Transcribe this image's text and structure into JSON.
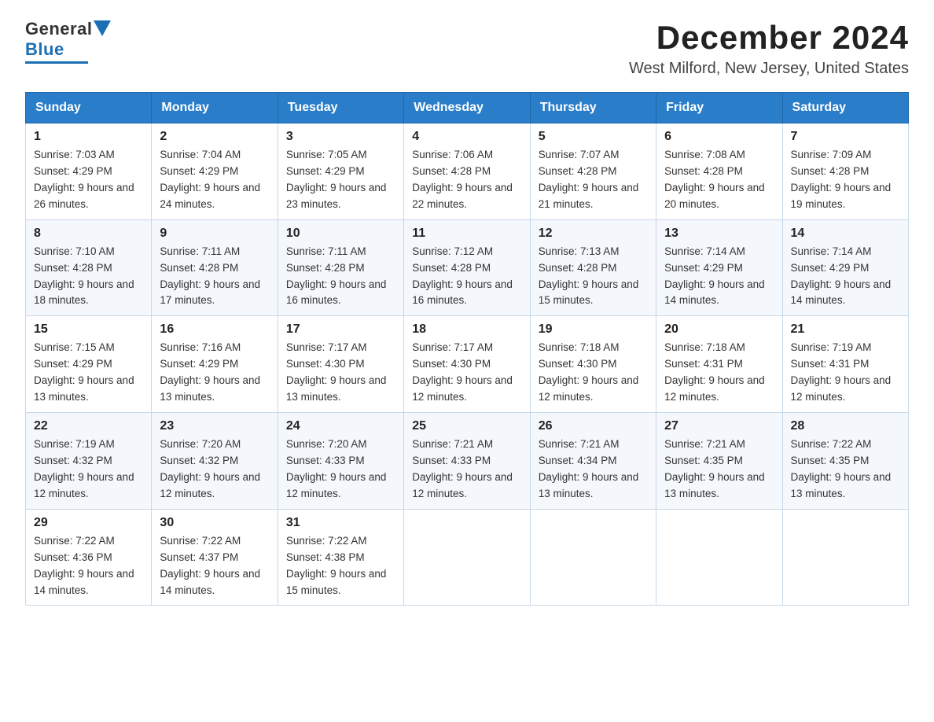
{
  "logo": {
    "general": "General",
    "blue": "Blue"
  },
  "title": "December 2024",
  "location": "West Milford, New Jersey, United States",
  "weekdays": [
    "Sunday",
    "Monday",
    "Tuesday",
    "Wednesday",
    "Thursday",
    "Friday",
    "Saturday"
  ],
  "weeks": [
    [
      {
        "day": "1",
        "sunrise": "7:03 AM",
        "sunset": "4:29 PM",
        "daylight": "9 hours and 26 minutes."
      },
      {
        "day": "2",
        "sunrise": "7:04 AM",
        "sunset": "4:29 PM",
        "daylight": "9 hours and 24 minutes."
      },
      {
        "day": "3",
        "sunrise": "7:05 AM",
        "sunset": "4:29 PM",
        "daylight": "9 hours and 23 minutes."
      },
      {
        "day": "4",
        "sunrise": "7:06 AM",
        "sunset": "4:28 PM",
        "daylight": "9 hours and 22 minutes."
      },
      {
        "day": "5",
        "sunrise": "7:07 AM",
        "sunset": "4:28 PM",
        "daylight": "9 hours and 21 minutes."
      },
      {
        "day": "6",
        "sunrise": "7:08 AM",
        "sunset": "4:28 PM",
        "daylight": "9 hours and 20 minutes."
      },
      {
        "day": "7",
        "sunrise": "7:09 AM",
        "sunset": "4:28 PM",
        "daylight": "9 hours and 19 minutes."
      }
    ],
    [
      {
        "day": "8",
        "sunrise": "7:10 AM",
        "sunset": "4:28 PM",
        "daylight": "9 hours and 18 minutes."
      },
      {
        "day": "9",
        "sunrise": "7:11 AM",
        "sunset": "4:28 PM",
        "daylight": "9 hours and 17 minutes."
      },
      {
        "day": "10",
        "sunrise": "7:11 AM",
        "sunset": "4:28 PM",
        "daylight": "9 hours and 16 minutes."
      },
      {
        "day": "11",
        "sunrise": "7:12 AM",
        "sunset": "4:28 PM",
        "daylight": "9 hours and 16 minutes."
      },
      {
        "day": "12",
        "sunrise": "7:13 AM",
        "sunset": "4:28 PM",
        "daylight": "9 hours and 15 minutes."
      },
      {
        "day": "13",
        "sunrise": "7:14 AM",
        "sunset": "4:29 PM",
        "daylight": "9 hours and 14 minutes."
      },
      {
        "day": "14",
        "sunrise": "7:14 AM",
        "sunset": "4:29 PM",
        "daylight": "9 hours and 14 minutes."
      }
    ],
    [
      {
        "day": "15",
        "sunrise": "7:15 AM",
        "sunset": "4:29 PM",
        "daylight": "9 hours and 13 minutes."
      },
      {
        "day": "16",
        "sunrise": "7:16 AM",
        "sunset": "4:29 PM",
        "daylight": "9 hours and 13 minutes."
      },
      {
        "day": "17",
        "sunrise": "7:17 AM",
        "sunset": "4:30 PM",
        "daylight": "9 hours and 13 minutes."
      },
      {
        "day": "18",
        "sunrise": "7:17 AM",
        "sunset": "4:30 PM",
        "daylight": "9 hours and 12 minutes."
      },
      {
        "day": "19",
        "sunrise": "7:18 AM",
        "sunset": "4:30 PM",
        "daylight": "9 hours and 12 minutes."
      },
      {
        "day": "20",
        "sunrise": "7:18 AM",
        "sunset": "4:31 PM",
        "daylight": "9 hours and 12 minutes."
      },
      {
        "day": "21",
        "sunrise": "7:19 AM",
        "sunset": "4:31 PM",
        "daylight": "9 hours and 12 minutes."
      }
    ],
    [
      {
        "day": "22",
        "sunrise": "7:19 AM",
        "sunset": "4:32 PM",
        "daylight": "9 hours and 12 minutes."
      },
      {
        "day": "23",
        "sunrise": "7:20 AM",
        "sunset": "4:32 PM",
        "daylight": "9 hours and 12 minutes."
      },
      {
        "day": "24",
        "sunrise": "7:20 AM",
        "sunset": "4:33 PM",
        "daylight": "9 hours and 12 minutes."
      },
      {
        "day": "25",
        "sunrise": "7:21 AM",
        "sunset": "4:33 PM",
        "daylight": "9 hours and 12 minutes."
      },
      {
        "day": "26",
        "sunrise": "7:21 AM",
        "sunset": "4:34 PM",
        "daylight": "9 hours and 13 minutes."
      },
      {
        "day": "27",
        "sunrise": "7:21 AM",
        "sunset": "4:35 PM",
        "daylight": "9 hours and 13 minutes."
      },
      {
        "day": "28",
        "sunrise": "7:22 AM",
        "sunset": "4:35 PM",
        "daylight": "9 hours and 13 minutes."
      }
    ],
    [
      {
        "day": "29",
        "sunrise": "7:22 AM",
        "sunset": "4:36 PM",
        "daylight": "9 hours and 14 minutes."
      },
      {
        "day": "30",
        "sunrise": "7:22 AM",
        "sunset": "4:37 PM",
        "daylight": "9 hours and 14 minutes."
      },
      {
        "day": "31",
        "sunrise": "7:22 AM",
        "sunset": "4:38 PM",
        "daylight": "9 hours and 15 minutes."
      },
      null,
      null,
      null,
      null
    ]
  ],
  "labels": {
    "sunrise": "Sunrise:",
    "sunset": "Sunset:",
    "daylight": "Daylight:"
  }
}
